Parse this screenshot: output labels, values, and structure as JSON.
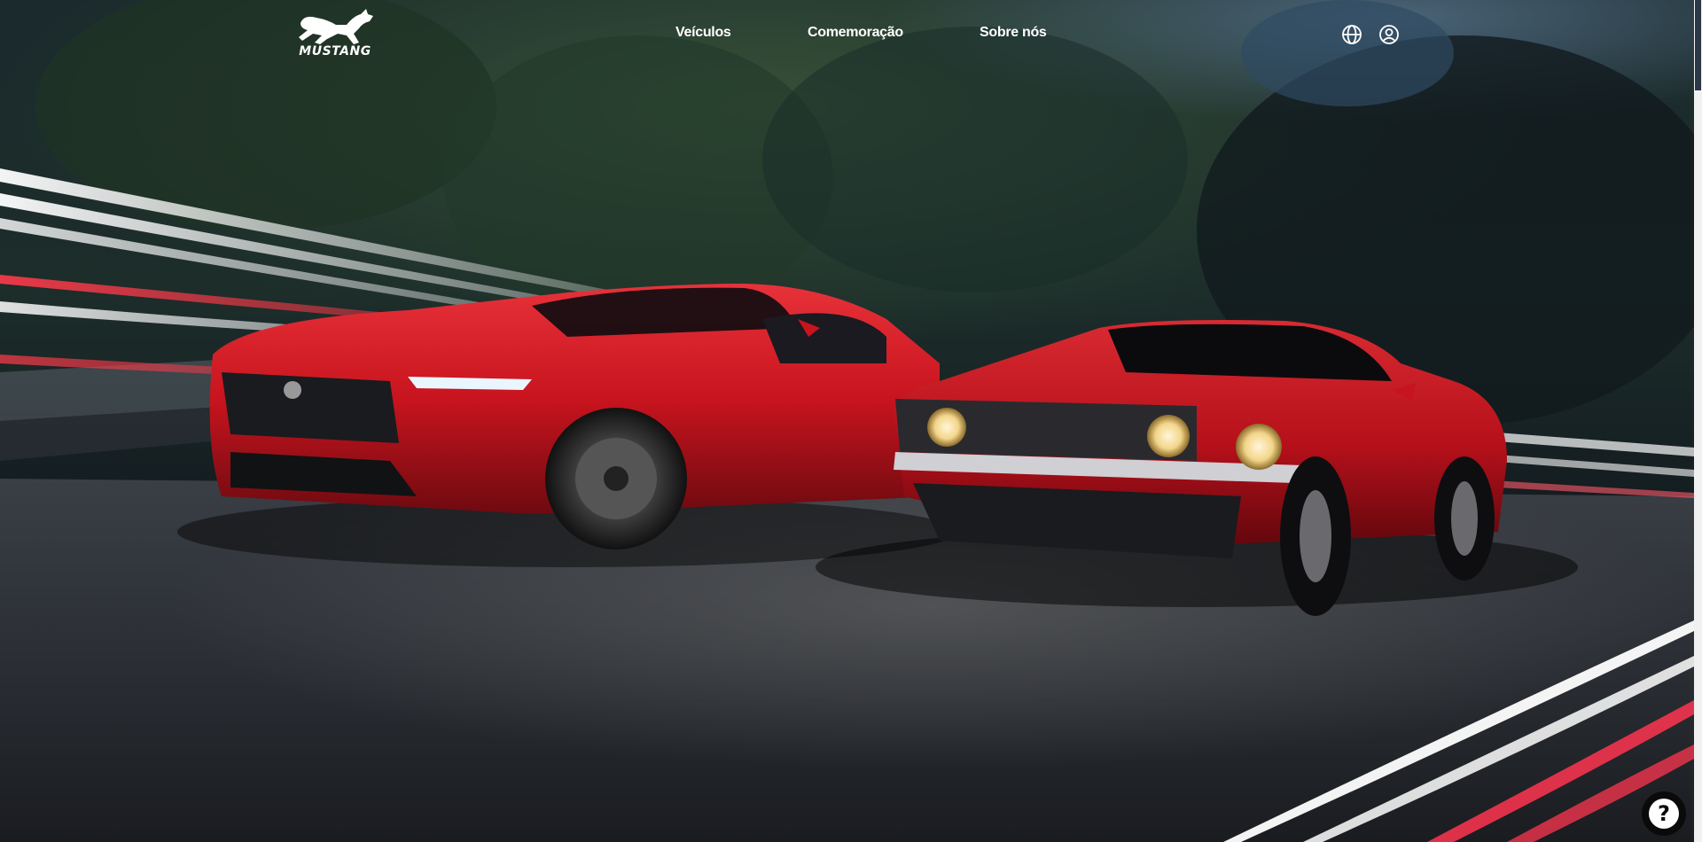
{
  "brand": {
    "logo_text": "MUSTANG",
    "logo_icon": "running-horse-icon"
  },
  "nav": {
    "items": [
      {
        "label": "Veículos"
      },
      {
        "label": "Comemoração"
      },
      {
        "label": "Sobre nós"
      }
    ]
  },
  "utility": {
    "language_icon": "globe-icon",
    "account_icon": "user-account-icon"
  },
  "help": {
    "label": "?",
    "icon": "help-icon"
  },
  "colors": {
    "nav_text": "#ffffff",
    "car_red": "#c8141e",
    "road": "#2a2d33",
    "sky": "#0e1a26"
  }
}
